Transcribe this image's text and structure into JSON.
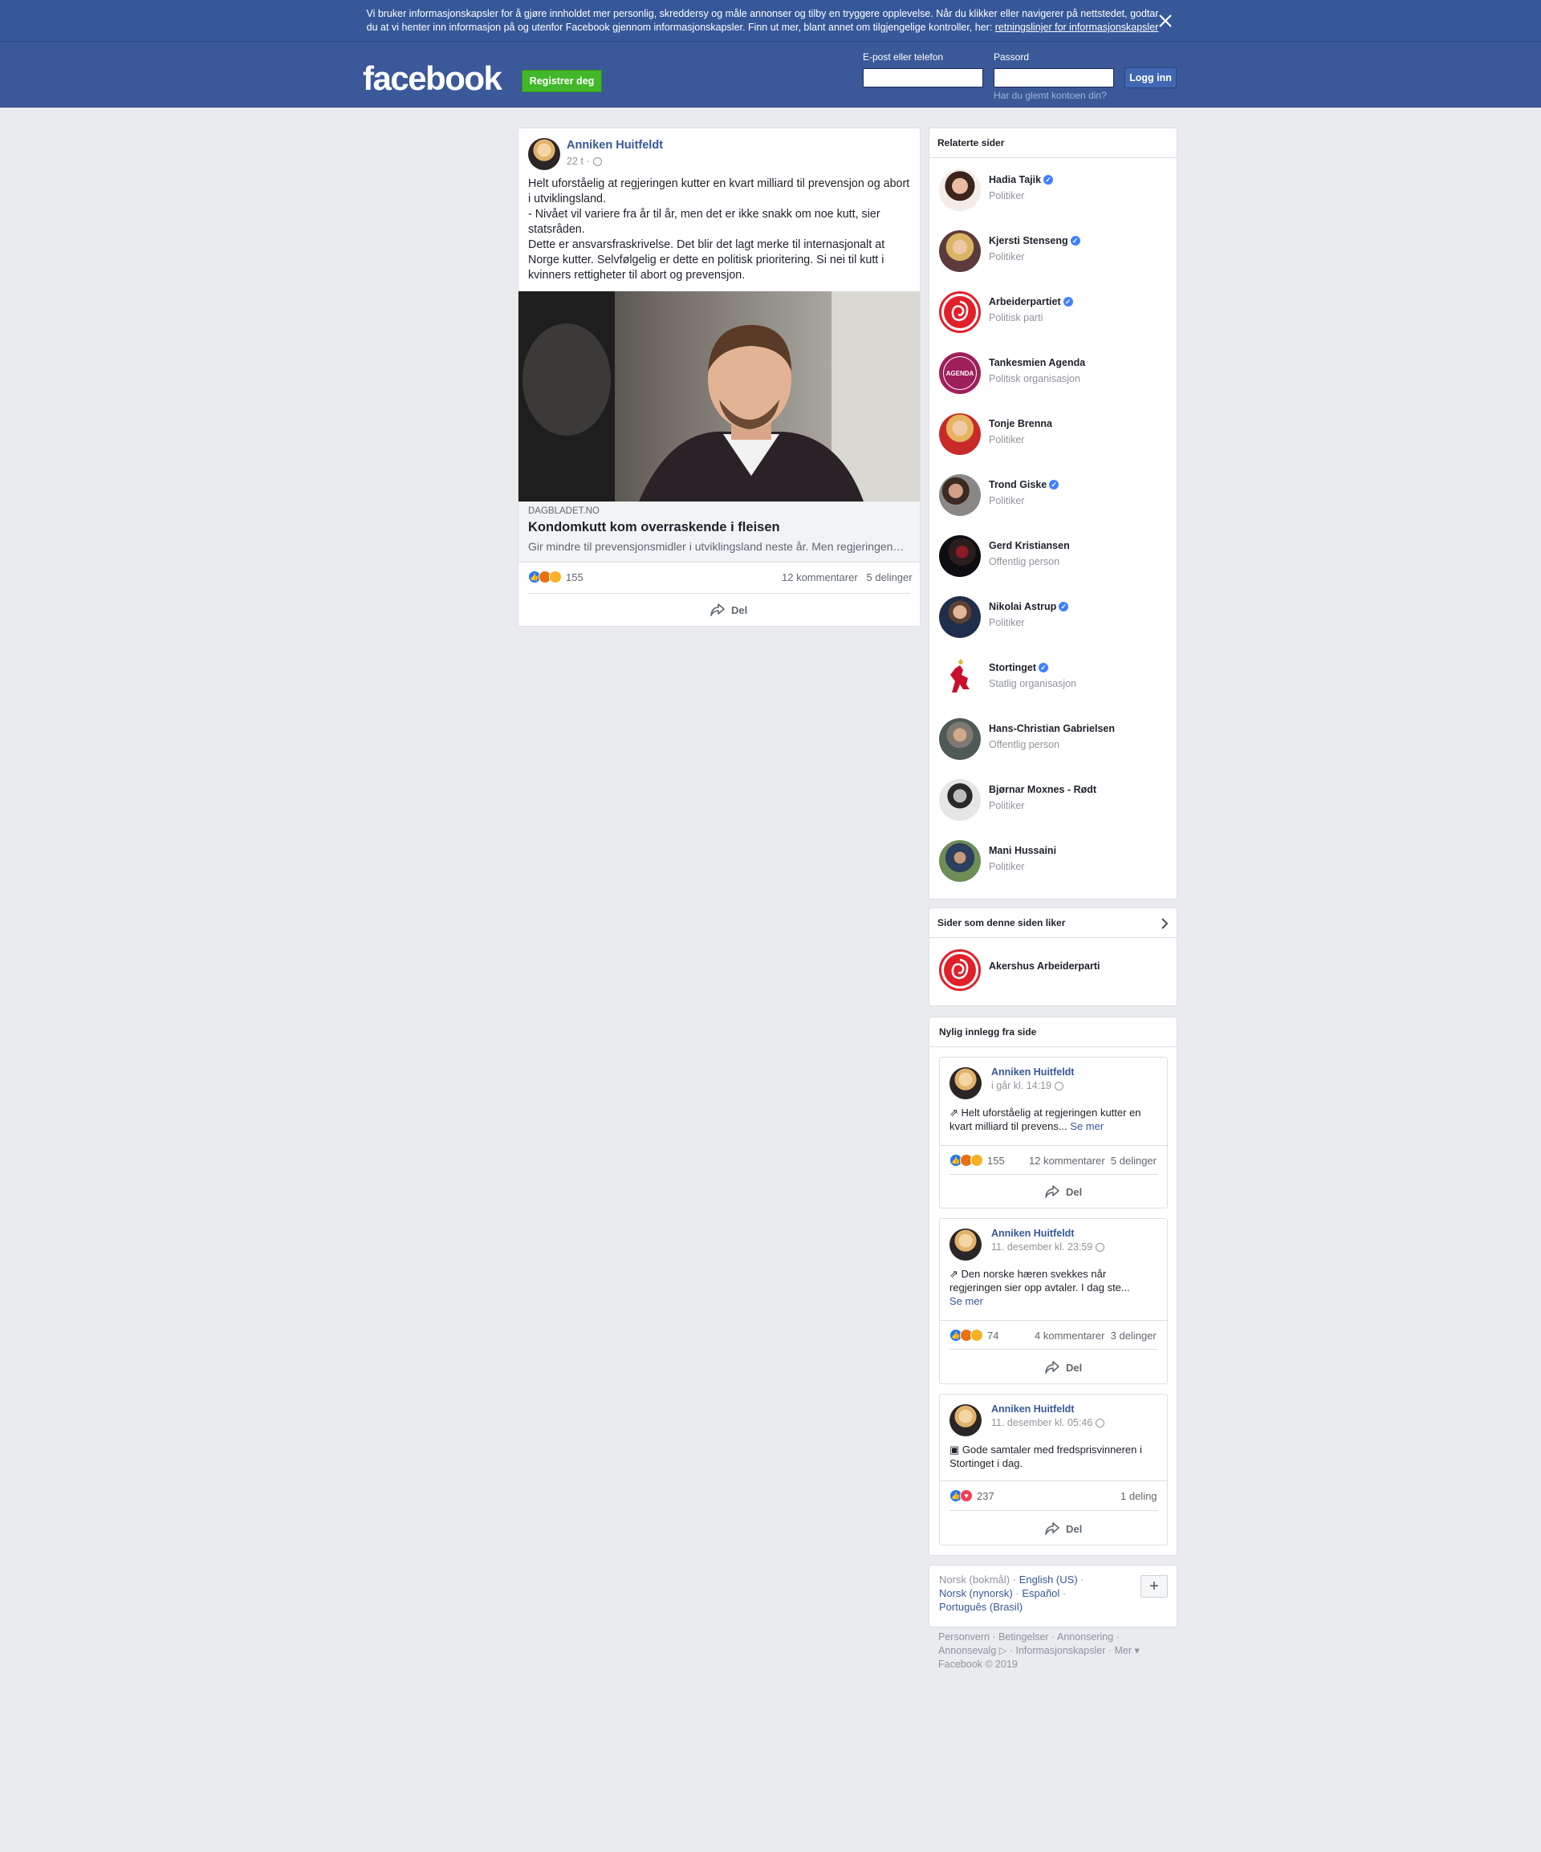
{
  "cookie": {
    "text": "Vi bruker informasjonskapsler for å gjøre innholdet mer personlig, skreddersy og måle annonser og tilby en tryggere opplevelse. Når du klikker eller navigerer på nettstedet, godtar du at vi henter inn informasjon på og utenfor Facebook gjennom informasjonskapsler. Finn ut mer, blant annet om tilgjengelige kontroller, her: ",
    "link": "retningslinjer for informasjonskapsler"
  },
  "header": {
    "logo": "facebook",
    "register": "Registrer deg",
    "email_label": "E-post eller telefon",
    "password_label": "Passord",
    "login": "Logg inn",
    "forgot": "Har du glemt kontoen din?"
  },
  "post": {
    "author": "Anniken Huitfeldt",
    "time": "22 t",
    "body": [
      "Helt uforståelig at regjeringen kutter en kvart milliard til prevensjon og abort i utviklingsland.",
      "- Nivået vil variere fra år til år, men det er ikke snakk om noe kutt, sier statsråden.",
      "Dette er ansvarsfraskrivelse. Det blir det lagt merke til internasjonalt at Norge kutter. Selvfølgelig er dette en politisk prioritering. Si nei til kutt i kvinners rettigheter til abort og prevensjon."
    ],
    "link_source": "DAGBLADET.NO",
    "link_title": "Kondomkutt kom overraskende i fleisen",
    "link_desc": "Gir mindre til prevensjonsmidler i utviklingsland neste år. Men regjeringen…",
    "reactions": "155",
    "comments": "12 kommentarer",
    "shares": "5 delinger",
    "share_label": "Del"
  },
  "related": {
    "title": "Relaterte sider",
    "items": [
      {
        "name": "Hadia Tajik",
        "category": "Politiker",
        "verified": true
      },
      {
        "name": "Kjersti Stenseng",
        "category": "Politiker",
        "verified": true
      },
      {
        "name": "Arbeiderpartiet",
        "category": "Politisk parti",
        "verified": true
      },
      {
        "name": "Tankesmien Agenda",
        "category": "Politisk organisasjon",
        "verified": false
      },
      {
        "name": "Tonje Brenna",
        "category": "Politiker",
        "verified": false
      },
      {
        "name": "Trond Giske",
        "category": "Politiker",
        "verified": true
      },
      {
        "name": "Gerd Kristiansen",
        "category": "Offentlig person",
        "verified": false
      },
      {
        "name": "Nikolai Astrup",
        "category": "Politiker",
        "verified": true
      },
      {
        "name": "Stortinget",
        "category": "Statlig organisasjon",
        "verified": true
      },
      {
        "name": "Hans-Christian Gabrielsen",
        "category": "Offentlig person",
        "verified": false
      },
      {
        "name": "Bjørnar Moxnes - Rødt",
        "category": "Politiker",
        "verified": false
      },
      {
        "name": "Mani Hussaini",
        "category": "Politiker",
        "verified": false
      }
    ]
  },
  "likes": {
    "title": "Sider som denne siden liker",
    "item": "Akershus Arbeiderparti"
  },
  "recent": {
    "title": "Nylig innlegg fra side",
    "posts": [
      {
        "author": "Anniken Huitfeldt",
        "time": "i går kl. 14:19",
        "text": "Helt uforståelig at regjeringen kutter en kvart milliard til prevens...",
        "more": "Se mer",
        "reactions": "155",
        "comments": "12 kommentarer",
        "shares": "5 delinger",
        "share_label": "Del"
      },
      {
        "author": "Anniken Huitfeldt",
        "time": "11. desember kl. 23:59",
        "text": "Den norske hæren svekkes når regjeringen sier opp avtaler. I dag ste...",
        "more": "Se mer",
        "reactions": "74",
        "comments": "4 kommentarer",
        "shares": "3 delinger",
        "share_label": "Del"
      },
      {
        "author": "Anniken Huitfeldt",
        "time": "11. desember kl. 05:46",
        "text": "Gode samtaler med fredsprisvinneren i Stortinget i dag.",
        "more": "",
        "reactions": "237",
        "comments": "",
        "shares": "1 deling",
        "share_label": "Del"
      }
    ]
  },
  "languages": {
    "current": "Norsk (bokmål)",
    "options": [
      "English (US)",
      "Norsk (nynorsk)",
      "Español",
      "Português (Brasil)"
    ]
  },
  "footer": {
    "links": [
      "Personvern",
      "Betingelser",
      "Annonsering",
      "Annonsevalg",
      "Informasjonskapsler",
      "Mer"
    ],
    "copyright": "Facebook © 2019"
  },
  "colors": {
    "brand": "#3b5998",
    "link": "#365899",
    "register": "#42b72a",
    "verified": "#4080ff"
  }
}
